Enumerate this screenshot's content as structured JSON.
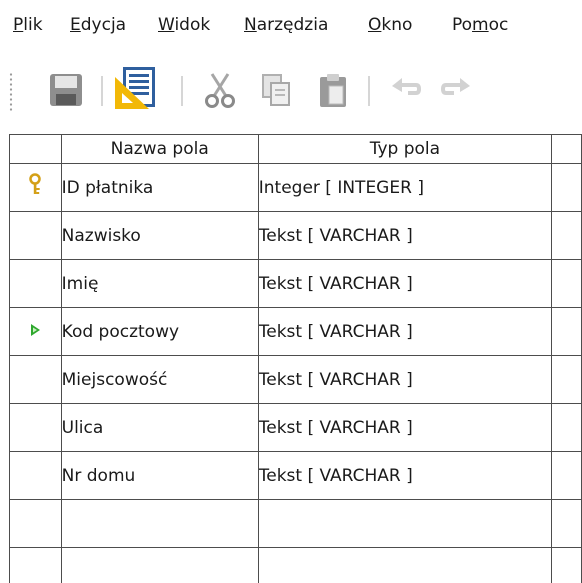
{
  "menu": {
    "items": [
      {
        "before": "",
        "mnemonic": "P",
        "after": "lik"
      },
      {
        "before": "",
        "mnemonic": "E",
        "after": "dycja"
      },
      {
        "before": "",
        "mnemonic": "W",
        "after": "idok"
      },
      {
        "before": "",
        "mnemonic": "N",
        "after": "arzędzia"
      },
      {
        "before": "",
        "mnemonic": "O",
        "after": "kno"
      },
      {
        "before": "Po",
        "mnemonic": "m",
        "after": "oc"
      }
    ]
  },
  "toolbar": {
    "icons": [
      "save-icon",
      "design-view-icon",
      "cut-icon",
      "copy-icon",
      "paste-icon",
      "undo-icon",
      "redo-icon"
    ]
  },
  "grid": {
    "columns": [
      "Nazwa pola",
      "Typ pola"
    ],
    "rows": [
      {
        "marker": "primary-key",
        "name": "ID płatnika",
        "type": "Integer [ INTEGER ]"
      },
      {
        "marker": "",
        "name": "Nazwisko",
        "type": "Tekst [ VARCHAR ]"
      },
      {
        "marker": "",
        "name": "Imię",
        "type": "Tekst [ VARCHAR ]"
      },
      {
        "marker": "current",
        "name": "Kod pocztowy",
        "type": "Tekst [ VARCHAR ]"
      },
      {
        "marker": "",
        "name": "Miejscowość",
        "type": "Tekst [ VARCHAR ]"
      },
      {
        "marker": "",
        "name": "Ulica",
        "type": "Tekst [ VARCHAR ]"
      },
      {
        "marker": "",
        "name": "Nr domu",
        "type": "Tekst [ VARCHAR ]"
      }
    ],
    "empty_rows": 2
  },
  "colors": {
    "key_icon": "#d4a017",
    "current_row_arrow": "#2ea82e"
  }
}
